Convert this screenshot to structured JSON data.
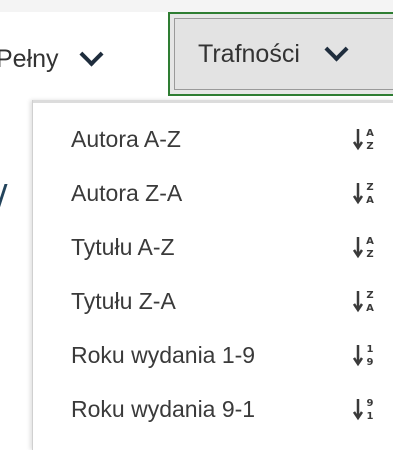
{
  "toolbar": {
    "format_select": {
      "value": "Pełny",
      "icon": "chevron-down-icon"
    },
    "sort_select": {
      "value": "Trafności",
      "icon": "chevron-down-icon",
      "focus_color": "#2e7d32"
    }
  },
  "sort_menu": {
    "options": [
      {
        "label": "Autora A-Z",
        "icon": "sort-alpha-asc-icon"
      },
      {
        "label": "Autora Z-A",
        "icon": "sort-alpha-desc-icon"
      },
      {
        "label": "Tytułu A-Z",
        "icon": "sort-alpha-asc-icon"
      },
      {
        "label": "Tytułu Z-A",
        "icon": "sort-alpha-desc-icon"
      },
      {
        "label": "Roku wydania 1-9",
        "icon": "sort-numeric-asc-icon"
      },
      {
        "label": "Roku wydania 9-1",
        "icon": "sort-numeric-desc-icon"
      }
    ]
  }
}
